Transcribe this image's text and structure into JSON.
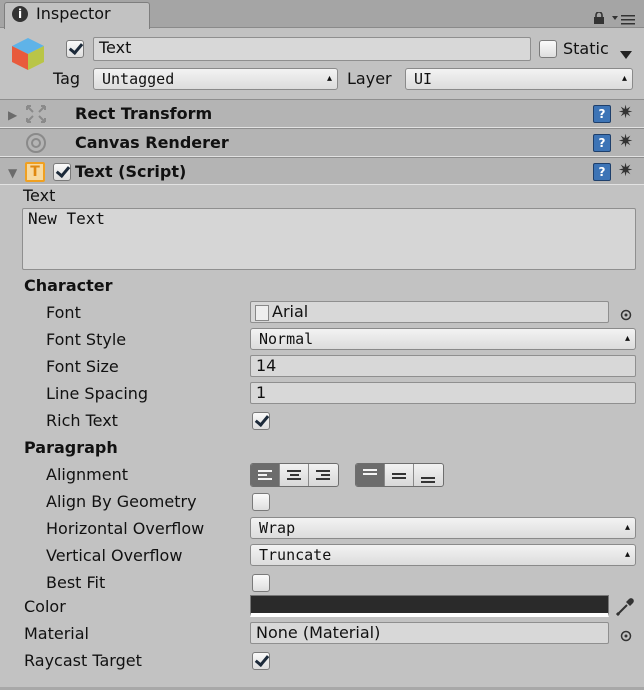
{
  "tab": {
    "icon": "info-icon",
    "title": "Inspector"
  },
  "window_controls": {
    "lock": "lock-icon",
    "menu": "menu-icon"
  },
  "gameobject": {
    "icon": "cube-icon",
    "active": true,
    "name": "Text",
    "static_label": "Static",
    "static_checked": false,
    "tag_label": "Tag",
    "tag_value": "Untagged",
    "layer_label": "Layer",
    "layer_value": "UI"
  },
  "components": [
    {
      "name": "Rect Transform",
      "icon": "rect-transform-icon",
      "expanded": false
    },
    {
      "name": "Canvas Renderer",
      "icon": "canvas-renderer-icon",
      "expanded": false
    },
    {
      "name": "Text (Script)",
      "icon": "text-component-icon",
      "expanded": true,
      "enabled": true
    }
  ],
  "text_component": {
    "text_label": "Text",
    "text_value": "New Text",
    "character_header": "Character",
    "font_label": "Font",
    "font_value": "Arial",
    "font_style_label": "Font Style",
    "font_style_value": "Normal",
    "font_size_label": "Font Size",
    "font_size_value": "14",
    "line_spacing_label": "Line Spacing",
    "line_spacing_value": "1",
    "rich_text_label": "Rich Text",
    "rich_text_checked": true,
    "paragraph_header": "Paragraph",
    "alignment_label": "Alignment",
    "horizontal_alignment": [
      "left",
      "center",
      "right"
    ],
    "horizontal_selected": "left",
    "vertical_alignment": [
      "top",
      "middle",
      "bottom"
    ],
    "vertical_selected": "top",
    "align_by_geometry_label": "Align By Geometry",
    "align_by_geometry_checked": false,
    "horizontal_overflow_label": "Horizontal Overflow",
    "horizontal_overflow_value": "Wrap",
    "vertical_overflow_label": "Vertical Overflow",
    "vertical_overflow_value": "Truncate",
    "best_fit_label": "Best Fit",
    "best_fit_checked": false,
    "color_label": "Color",
    "color_value": "#2a2a2a",
    "material_label": "Material",
    "material_value": "None (Material)",
    "raycast_target_label": "Raycast Target",
    "raycast_target_checked": true
  }
}
